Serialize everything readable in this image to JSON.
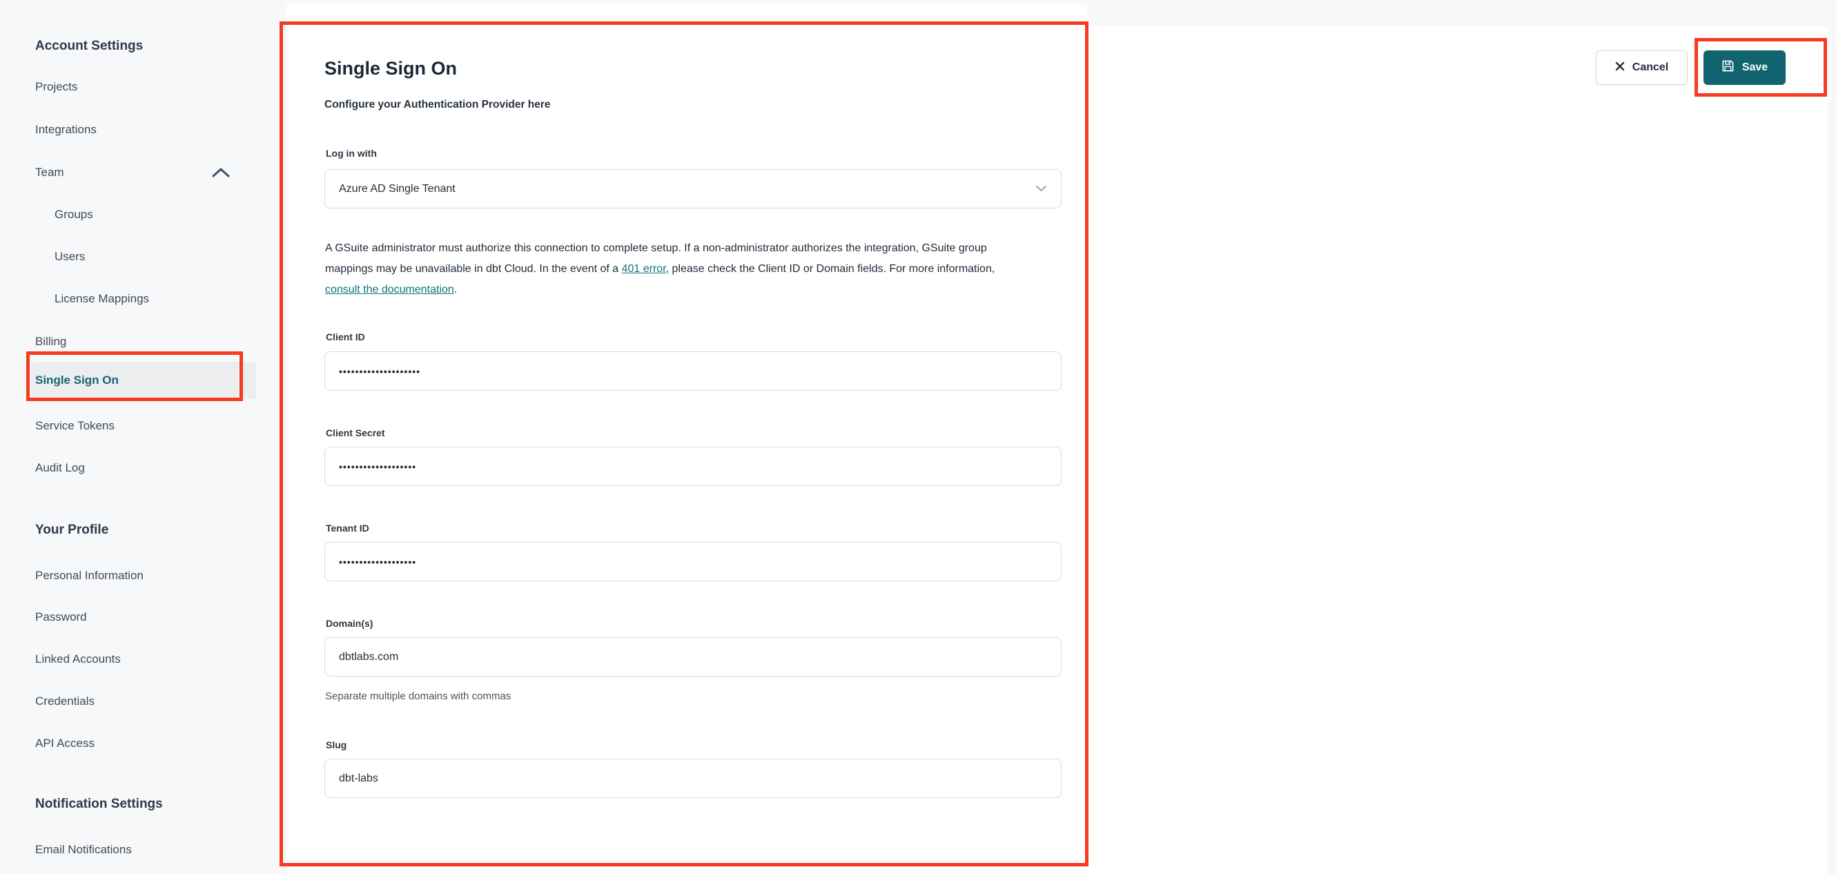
{
  "sidebar": {
    "account_settings_heading": "Account Settings",
    "items": {
      "projects": "Projects",
      "integrations": "Integrations",
      "team": "Team",
      "groups": "Groups",
      "users": "Users",
      "license_mappings": "License Mappings",
      "billing": "Billing",
      "single_sign_on": "Single Sign On",
      "service_tokens": "Service Tokens",
      "audit_log": "Audit Log"
    },
    "your_profile_heading": "Your Profile",
    "profile_items": {
      "personal_information": "Personal Information",
      "password": "Password",
      "linked_accounts": "Linked Accounts",
      "credentials": "Credentials",
      "api_access": "API Access"
    },
    "notification_settings_heading": "Notification Settings",
    "notification_items": {
      "email_notifications": "Email Notifications"
    }
  },
  "header": {
    "cancel_label": "Cancel",
    "save_label": "Save"
  },
  "main": {
    "title": "Single Sign On",
    "subtitle": "Configure your Authentication Provider here",
    "login_with": {
      "label": "Log in with",
      "value": "Azure AD Single Tenant"
    },
    "notice": {
      "text_before_401": "A GSuite administrator must authorize this connection to complete setup. If a non-administrator authorizes the integration, GSuite group mappings may be unavailable in dbt Cloud. In the event of a ",
      "link_401": "401 error",
      "text_middle": ", please check the Client ID or Domain fields. For more information, ",
      "link_docs": "consult the documentation",
      "text_after": "."
    },
    "fields": {
      "client_id": {
        "label": "Client ID",
        "value": "••••••••••••••••••••"
      },
      "client_secret": {
        "label": "Client Secret",
        "value": "•••••••••••••••••••"
      },
      "tenant_id": {
        "label": "Tenant ID",
        "value": "•••••••••••••••••••"
      },
      "domains": {
        "label": "Domain(s)",
        "value": "dbtlabs.com",
        "helper": "Separate multiple domains with commas"
      },
      "slug": {
        "label": "Slug",
        "value": "dbt-labs"
      }
    }
  },
  "colors": {
    "accent_teal": "#11636f",
    "link_teal": "#0e7280",
    "active_item_teal": "#15666f",
    "annotation_red": "#f63b22"
  }
}
